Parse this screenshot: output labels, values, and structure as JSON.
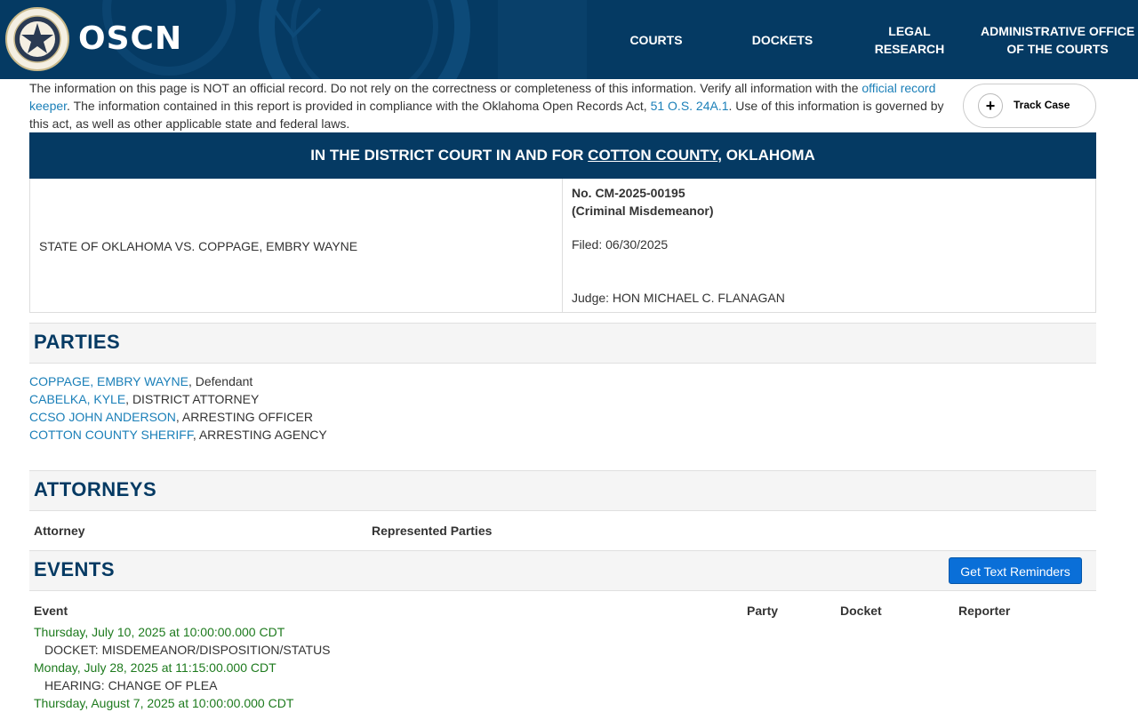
{
  "header": {
    "logo_text": "OSCN",
    "nav": [
      {
        "label_line1": "COURTS",
        "label_line2": ""
      },
      {
        "label_line1": "DOCKETS",
        "label_line2": ""
      },
      {
        "label_line1": "LEGAL",
        "label_line2": "RESEARCH"
      },
      {
        "label_line1": "ADMINISTRATIVE OFFICE",
        "label_line2": "OF THE COURTS"
      }
    ],
    "colors": {
      "primary": "#053a63",
      "link": "#1a7fb8",
      "event_date": "#1d7a1d",
      "button": "#0a6fd8"
    }
  },
  "notice": {
    "text1": "The information on this page is NOT an official record. Do not rely on the correctness or completeness of this information. Verify all information with the ",
    "link1": "official record keeper",
    "text2": ". The information contained in this report is provided in compliance with the Oklahoma Open Records Act, ",
    "link2": "51 O.S. 24A.1",
    "text3": ". Use of this information is governed by this act, as well as other applicable state and federal laws."
  },
  "track_case": {
    "label": "Track Case",
    "icon": "plus-icon"
  },
  "court": {
    "prefix": "IN THE DISTRICT COURT IN AND FOR ",
    "county_link": "COTTON COUNTY",
    "suffix": ", OKLAHOMA"
  },
  "case": {
    "style": "STATE OF OKLAHOMA VS. COPPAGE, EMBRY WAYNE",
    "number": "No. CM-2025-00195",
    "type": "(Criminal Misdemeanor)",
    "filed": "Filed: 06/30/2025",
    "judge": "Judge: HON MICHAEL C. FLANAGAN"
  },
  "parties": {
    "heading": "PARTIES",
    "items": [
      {
        "name": "COPPAGE, EMBRY WAYNE",
        "role": ", Defendant"
      },
      {
        "name": "CABELKA, KYLE",
        "role": ", DISTRICT ATTORNEY"
      },
      {
        "name": "CCSO JOHN ANDERSON",
        "role": ", ARRESTING OFFICER"
      },
      {
        "name": "COTTON COUNTY SHERIFF",
        "role": ", ARRESTING AGENCY"
      }
    ]
  },
  "attorneys": {
    "heading": "ATTORNEYS",
    "col_attorney": "Attorney",
    "col_represented": "Represented Parties"
  },
  "events": {
    "heading": "EVENTS",
    "reminder_button": "Get Text Reminders",
    "columns": {
      "event": "Event",
      "party": "Party",
      "docket": "Docket",
      "reporter": "Reporter"
    },
    "items": [
      {
        "date": "Thursday, July 10, 2025 at 10:00:00.000 CDT",
        "desc": "DOCKET: MISDEMEANOR/DISPOSITION/STATUS"
      },
      {
        "date": "Monday, July 28, 2025 at 11:15:00.000 CDT",
        "desc": "HEARING: CHANGE OF PLEA"
      },
      {
        "date": "Thursday, August 7, 2025 at 10:00:00.000 CDT",
        "desc": ""
      }
    ]
  }
}
